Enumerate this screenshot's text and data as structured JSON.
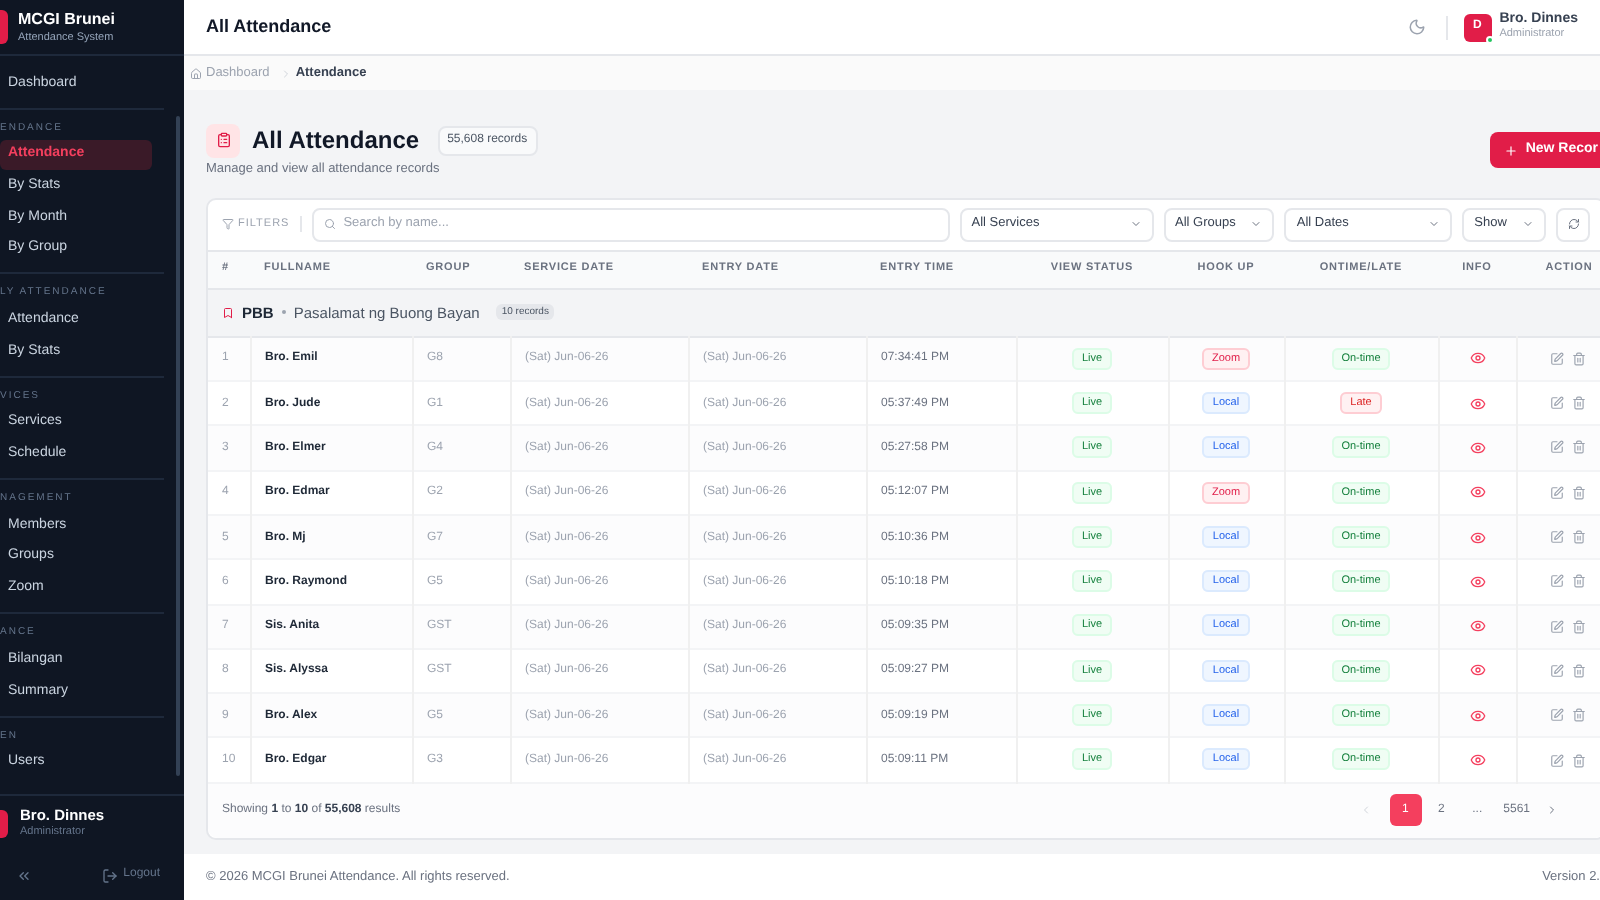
{
  "sidebar": {
    "app_title": "MCGI Brunei",
    "app_subtitle": "Attendance System",
    "top_item": {
      "label": "Dashboard",
      "selected": false
    },
    "sections": [
      {
        "label": "ENDANCE",
        "items": [
          {
            "label": "Attendance",
            "selected": true
          },
          {
            "label": "By Stats",
            "selected": false
          },
          {
            "label": "By Month",
            "selected": false
          },
          {
            "label": "By Group",
            "selected": false
          }
        ]
      },
      {
        "label": "LY ATTENDANCE",
        "items": [
          {
            "label": "Attendance",
            "selected": false
          },
          {
            "label": "By Stats",
            "selected": false
          }
        ]
      },
      {
        "label": "VICES",
        "items": [
          {
            "label": "Services",
            "selected": false
          },
          {
            "label": "Schedule",
            "selected": false
          }
        ]
      },
      {
        "label": "NAGEMENT",
        "items": [
          {
            "label": "Members",
            "selected": false
          },
          {
            "label": "Groups",
            "selected": false
          },
          {
            "label": "Zoom",
            "selected": false
          }
        ]
      },
      {
        "label": "ANCE",
        "items": [
          {
            "label": "Bilangan",
            "selected": false
          },
          {
            "label": "Summary",
            "selected": false
          }
        ]
      },
      {
        "label": "EN",
        "items": [
          {
            "label": "Users",
            "selected": false
          }
        ]
      }
    ],
    "user": {
      "name": "Bro. Dinnes",
      "role": "Administrator"
    },
    "logout": "Logout"
  },
  "header": {
    "title": "All Attendance",
    "user": {
      "initial": "D",
      "name": "Bro. Dinnes",
      "role": "Administrator",
      "online": true
    }
  },
  "breadcrumb": [
    {
      "label": "Dashboard"
    },
    {
      "label": "Attendance"
    }
  ],
  "page": {
    "title": "All Attendance",
    "count": "55,608 records",
    "subtitle": "Manage and view all attendance records",
    "new_button": "New Recor"
  },
  "filters": {
    "label": "FILTERS",
    "search": {
      "placeholder": "Search by name..."
    },
    "selects": [
      "All Services",
      "All Groups",
      "All Dates",
      "Show"
    ]
  },
  "table": {
    "columns": [
      "#",
      "FULLNAME",
      "GROUP",
      "SERVICE DATE",
      "ENTRY DATE",
      "ENTRY TIME",
      "VIEW STATUS",
      "HOOK UP",
      "ONTIME/LATE",
      "INFO",
      "ACTION"
    ],
    "group": {
      "code": "PBB",
      "name": "Pasalamat ng Buong Bayan",
      "count": "10 records"
    },
    "rows": [
      {
        "n": "1",
        "name": "Bro. Emil",
        "group": "G8",
        "service": "(Sat) Jun-06-26",
        "entry": "(Sat) Jun-06-26",
        "time": "07:34:41 PM",
        "view": "Live",
        "hook": {
          "text": "Zoom",
          "kind": "zoom"
        },
        "ontime": {
          "text": "On-time",
          "kind": "ontime"
        }
      },
      {
        "n": "2",
        "name": "Bro. Jude",
        "group": "G1",
        "service": "(Sat) Jun-06-26",
        "entry": "(Sat) Jun-06-26",
        "time": "05:37:49 PM",
        "view": "Live",
        "hook": {
          "text": "Local",
          "kind": "local"
        },
        "ontime": {
          "text": "Late",
          "kind": "late"
        }
      },
      {
        "n": "3",
        "name": "Bro. Elmer",
        "group": "G4",
        "service": "(Sat) Jun-06-26",
        "entry": "(Sat) Jun-06-26",
        "time": "05:27:58 PM",
        "view": "Live",
        "hook": {
          "text": "Local",
          "kind": "local"
        },
        "ontime": {
          "text": "On-time",
          "kind": "ontime"
        }
      },
      {
        "n": "4",
        "name": "Bro. Edmar",
        "group": "G2",
        "service": "(Sat) Jun-06-26",
        "entry": "(Sat) Jun-06-26",
        "time": "05:12:07 PM",
        "view": "Live",
        "hook": {
          "text": "Zoom",
          "kind": "zoom"
        },
        "ontime": {
          "text": "On-time",
          "kind": "ontime"
        }
      },
      {
        "n": "5",
        "name": "Bro. Mj",
        "group": "G7",
        "service": "(Sat) Jun-06-26",
        "entry": "(Sat) Jun-06-26",
        "time": "05:10:36 PM",
        "view": "Live",
        "hook": {
          "text": "Local",
          "kind": "local"
        },
        "ontime": {
          "text": "On-time",
          "kind": "ontime"
        }
      },
      {
        "n": "6",
        "name": "Bro. Raymond",
        "group": "G5",
        "service": "(Sat) Jun-06-26",
        "entry": "(Sat) Jun-06-26",
        "time": "05:10:18 PM",
        "view": "Live",
        "hook": {
          "text": "Local",
          "kind": "local"
        },
        "ontime": {
          "text": "On-time",
          "kind": "ontime"
        }
      },
      {
        "n": "7",
        "name": "Sis. Anita",
        "group": "GST",
        "service": "(Sat) Jun-06-26",
        "entry": "(Sat) Jun-06-26",
        "time": "05:09:35 PM",
        "view": "Live",
        "hook": {
          "text": "Local",
          "kind": "local"
        },
        "ontime": {
          "text": "On-time",
          "kind": "ontime"
        }
      },
      {
        "n": "8",
        "name": "Sis. Alyssa",
        "group": "GST",
        "service": "(Sat) Jun-06-26",
        "entry": "(Sat) Jun-06-26",
        "time": "05:09:27 PM",
        "view": "Live",
        "hook": {
          "text": "Local",
          "kind": "local"
        },
        "ontime": {
          "text": "On-time",
          "kind": "ontime"
        }
      },
      {
        "n": "9",
        "name": "Bro. Alex",
        "group": "G5",
        "service": "(Sat) Jun-06-26",
        "entry": "(Sat) Jun-06-26",
        "time": "05:09:19 PM",
        "view": "Live",
        "hook": {
          "text": "Local",
          "kind": "local"
        },
        "ontime": {
          "text": "On-time",
          "kind": "ontime"
        }
      },
      {
        "n": "10",
        "name": "Bro. Edgar",
        "group": "G3",
        "service": "(Sat) Jun-06-26",
        "entry": "(Sat) Jun-06-26",
        "time": "05:09:11 PM",
        "view": "Live",
        "hook": {
          "text": "Local",
          "kind": "local"
        },
        "ontime": {
          "text": "On-time",
          "kind": "ontime"
        }
      }
    ]
  },
  "pagination": {
    "summary": "Showing **1** to **10** of **55,608** results",
    "pages": [
      {
        "label": "1",
        "selected": true
      },
      {
        "label": "2",
        "selected": false
      },
      {
        "label": "...",
        "selected": false
      },
      {
        "label": "5561",
        "selected": false
      }
    ]
  },
  "footer": {
    "copyright": "© 2026 MCGI Brunei Attendance. All rights reserved.",
    "version": "Version 2."
  }
}
